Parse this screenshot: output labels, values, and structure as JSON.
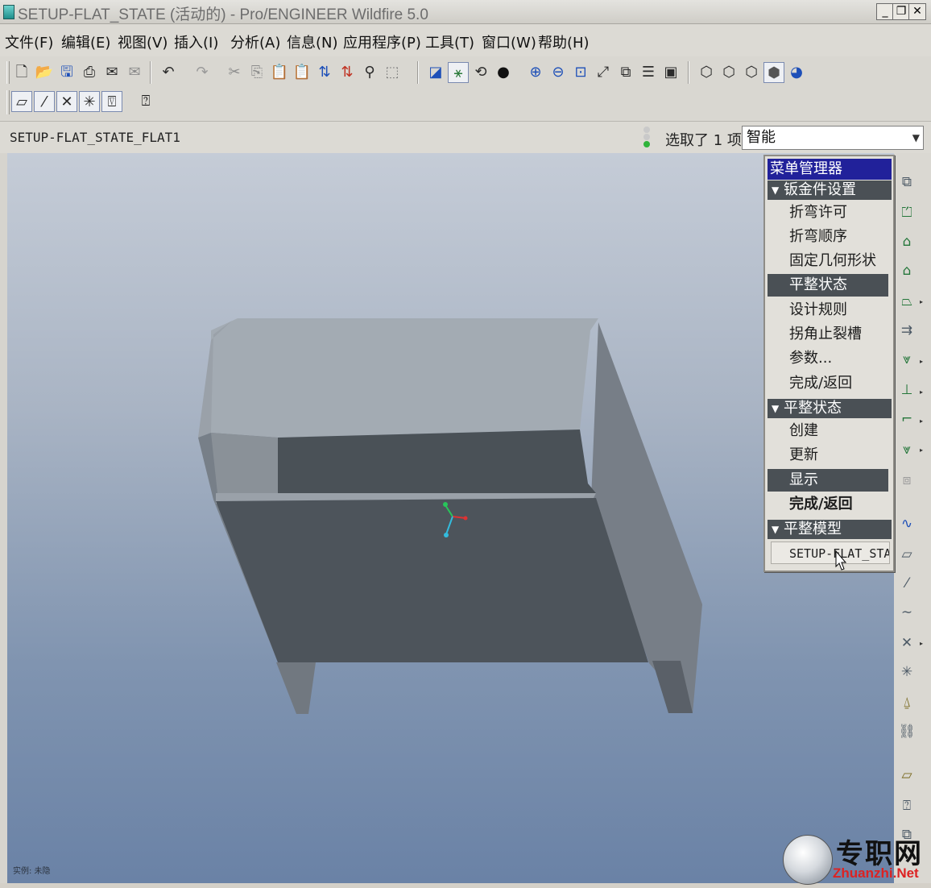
{
  "window": {
    "title": "SETUP-FLAT_STATE (活动的) - Pro/ENGINEER Wildfire 5.0",
    "minimize": "_",
    "restore": "❐",
    "close": "✕"
  },
  "menubar": {
    "items": [
      "文件(F)",
      "编辑(E)",
      "视图(V)",
      "插入(I)",
      "分析(A)",
      "信息(N)",
      "应用程序(P)",
      "工具(T)",
      "窗口(W)",
      "帮助(H)"
    ]
  },
  "toolbar": {
    "row1_icons": [
      "new-icon",
      "open-icon",
      "save-icon",
      "print-icon",
      "email-icon",
      "email-link-icon",
      "undo-icon",
      "redo-icon",
      "cut-icon",
      "copy-icon",
      "paste-icon",
      "paste-special-icon",
      "regenerate-icon",
      "regen-manager-icon",
      "find-icon",
      "select-box-icon",
      "repaint-icon",
      "spin-center-icon",
      "orient-mode-icon",
      "appearance-icon",
      "zoom-in-icon",
      "zoom-out-icon",
      "refit-icon",
      "reorient-icon",
      "saved-views-icon",
      "layers-icon",
      "view-manager-icon",
      "wireframe-icon",
      "hidden-line-icon",
      "no-hidden-icon",
      "shading-icon",
      "display-style-icon"
    ],
    "row2_icons": [
      "datum-planes-icon",
      "datum-axes-icon",
      "datum-points-icon",
      "coordinate-systems-icon",
      "annotations-icon",
      "context-help-icon"
    ]
  },
  "status": {
    "model_name": "SETUP-FLAT_STATE_FLAT1",
    "selection_text": "选取了 1 项",
    "filter_value": "智能",
    "traffic_colors": [
      "#c9c9c9",
      "#c9c9c9",
      "#2fb33a"
    ]
  },
  "menu_manager": {
    "title": "菜单管理器",
    "sections": [
      {
        "header": "钣金件设置",
        "items": [
          "折弯许可",
          "折弯顺序",
          "固定几何形状",
          "平整状态",
          "设计规则",
          "拐角止裂槽",
          "参数...",
          "完成/返回"
        ],
        "active": "平整状态"
      },
      {
        "header": "平整状态",
        "items": [
          "创建",
          "更新",
          "显示",
          "完成/返回"
        ],
        "active": "显示",
        "bold": "完成/返回"
      },
      {
        "header": "平整模型",
        "items": [
          "SETUP-FLAT_STATE"
        ]
      }
    ]
  },
  "right_toolbar": {
    "icons": [
      "sheetmetal-convert-icon",
      "flat-wall-icon",
      "flange-wall-icon",
      "unattached-wall-icon",
      "extend-icon",
      "rip-icon",
      "unbend-icon",
      "bend-back-icon",
      "bend-icon",
      "flat-pattern-icon",
      "form-icon",
      "sketch-icon",
      "plane-icon",
      "axis-icon",
      "curve-icon",
      "point-icon",
      "csys-icon",
      "analysis-icon",
      "datum-feature-icon",
      "edit-icon",
      "view-icon",
      "annotation-icon"
    ]
  },
  "viewport": {
    "note": "实例: 未隐",
    "background_top": "#c5ccd7",
    "background_bottom": "#6a82a6"
  },
  "watermark": {
    "cn": "专职网",
    "en": "Zhuanzhi.Net"
  }
}
